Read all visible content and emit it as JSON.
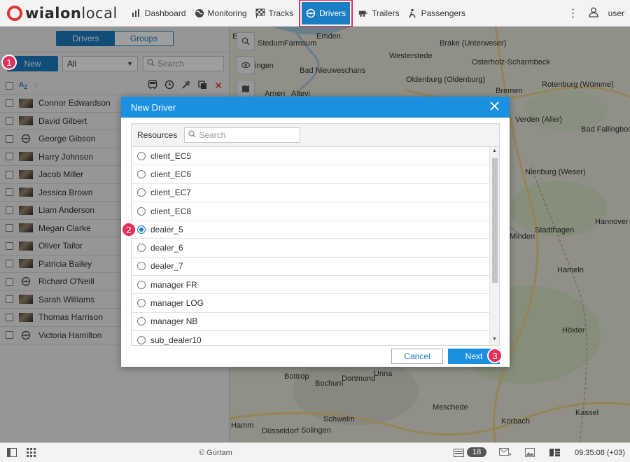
{
  "app": {
    "logo_main": "wialon",
    "logo_sub": "local"
  },
  "nav": {
    "items": [
      {
        "label": "Dashboard",
        "icon": "chart-icon"
      },
      {
        "label": "Monitoring",
        "icon": "globe-icon"
      },
      {
        "label": "Tracks",
        "icon": "flag-icon"
      },
      {
        "label": "Drivers",
        "icon": "steering-wheel-icon",
        "active": true
      },
      {
        "label": "Trailers",
        "icon": "trailer-icon"
      },
      {
        "label": "Passengers",
        "icon": "passenger-icon"
      }
    ],
    "user": "user"
  },
  "left": {
    "tabs": {
      "drivers": "Drivers",
      "groups": "Groups"
    },
    "new_label": "New",
    "filter_value": "All",
    "search_placeholder": "Search",
    "drivers": [
      {
        "name": "Connor Edwardson",
        "pic": "photo"
      },
      {
        "name": "David Gilbert",
        "pic": "photo"
      },
      {
        "name": "George Gibson",
        "pic": "wheel"
      },
      {
        "name": "Harry Johnson",
        "pic": "photo"
      },
      {
        "name": "Jacob Miller",
        "pic": "photo"
      },
      {
        "name": "Jessica Brown",
        "pic": "photo"
      },
      {
        "name": "Liam Anderson",
        "pic": "photo"
      },
      {
        "name": "Megan Clarke",
        "pic": "photo"
      },
      {
        "name": "Oliver Tailor",
        "pic": "photo"
      },
      {
        "name": "Patricia Bailey",
        "pic": "photo"
      },
      {
        "name": "Richard O'Neill",
        "pic": "wheel"
      },
      {
        "name": "Sarah Williams",
        "pic": "photo"
      },
      {
        "name": "Thomas Harrison",
        "pic": "photo"
      },
      {
        "name": "Victoria Hamilton",
        "pic": "wheel"
      }
    ]
  },
  "map": {
    "places": [
      "StedumFarmsum",
      "Emden",
      "Brake (Unterweser)",
      "Westerstede",
      "Osterholz-Scharmbeck",
      "ingen",
      "Bad Nieuweschans",
      "Oldenburg (Oldenburg)",
      "Bremen",
      "Rotenburg (Wümme)",
      "Verden (Aller)",
      "Bad Fallingbostel",
      "Nienburg (Weser)",
      "Hannover",
      "Stadthagen",
      "Minden",
      "Hameln",
      "Höxter",
      "Bottrop",
      "Bochum",
      "Dortmund",
      "Unna",
      "Meschede",
      "Korbach",
      "Kassel",
      "Schwelm",
      "Düsseldorf",
      "Solingen",
      "Hamm",
      "Eso",
      "Arnen",
      "Altevi"
    ]
  },
  "dialog": {
    "title": "New Driver",
    "resources_label": "Resources",
    "search_placeholder": "Search",
    "resources": [
      "client_EC5",
      "client_EC6",
      "client_EC7",
      "client_EC8",
      "dealer_5",
      "dealer_6",
      "dealer_7",
      "manager FR",
      "manager LOG",
      "manager NB",
      "sub_dealer10"
    ],
    "selected": "dealer_5",
    "cancel_label": "Cancel",
    "next_label": "Next"
  },
  "markers": [
    "1",
    "2",
    "3"
  ],
  "bottom": {
    "copyright": "© Gurtam",
    "badge": "18",
    "time": "09:35:08 (+03)"
  },
  "colors": {
    "accent": "#1b7ec3",
    "dialog_header": "#1b8fe0",
    "marker": "#e0325a",
    "logo_red": "#e2362f"
  }
}
